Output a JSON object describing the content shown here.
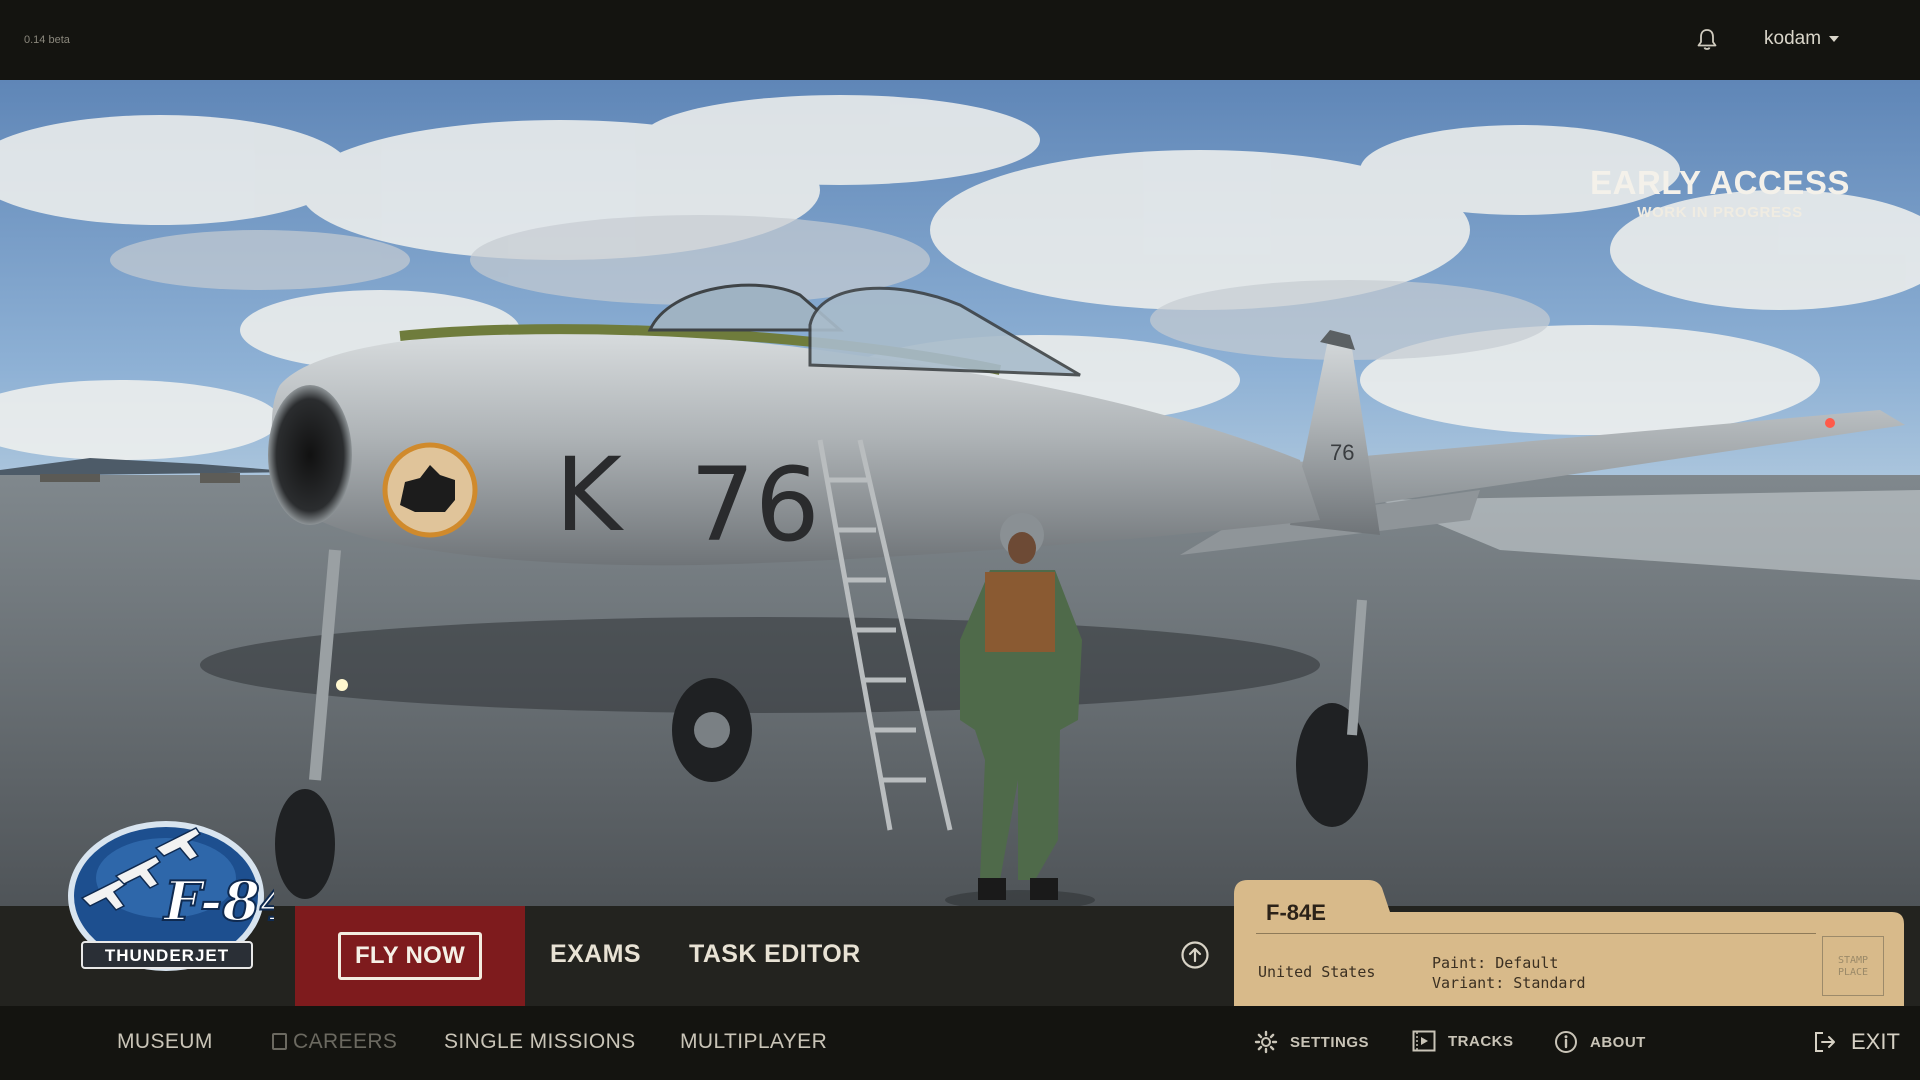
{
  "app": {
    "version": "0.14 beta",
    "username": "kodam"
  },
  "banner": {
    "line1": "EARLY ACCESS",
    "line2": "WORK IN PROGRESS"
  },
  "logo": {
    "model": "F-84",
    "name": "THUNDERJET"
  },
  "scene": {
    "aircraft_code": "K",
    "aircraft_number": "76",
    "tail_number": "76"
  },
  "actions": {
    "fly_now": "FLY NOW",
    "exams": "EXAMS",
    "task_editor": "TASK EDITOR"
  },
  "aircraft_card": {
    "name": "F-84E",
    "country": "United States",
    "paint": "Paint: Default",
    "variant": "Variant: Standard",
    "stamp_line1": "STAMP",
    "stamp_line2": "PLACE"
  },
  "nav": {
    "museum": "MUSEUM",
    "careers": "CAREERS",
    "single_missions": "SINGLE MISSIONS",
    "multiplayer": "MULTIPLAYER"
  },
  "utility": {
    "settings": "SETTINGS",
    "tracks": "TRACKS",
    "about": "ABOUT",
    "exit": "EXIT"
  },
  "colors": {
    "topbar": "#141410",
    "actionbar": "#23231f",
    "fly_now_bg": "#7e1b1d",
    "card_paper": "#d8ba8a",
    "text_light": "#e9e4d8"
  }
}
